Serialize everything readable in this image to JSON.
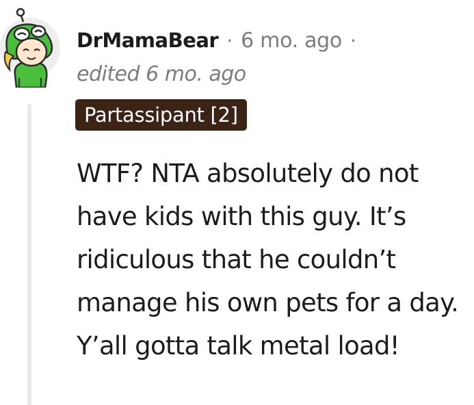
{
  "comment": {
    "author": "DrMamaBear",
    "separator": "·",
    "timestamp": "6 mo. ago",
    "edited": "edited 6 mo. ago",
    "flair": "Partassipant [2]",
    "body": "WTF? NTA absolutely do not have kids with this guy. It’s ridiculous that he couldn’t manage his own pets for a day. Y’all gotta talk metal load!"
  },
  "colors": {
    "text": "#1c1c1c",
    "meta": "#7c7c7c",
    "flair_bg": "#3b2316",
    "flair_text": "#ffffff",
    "thread_line": "#e9eaeb"
  },
  "icons": {
    "avatar": "frog-hood-avatar-icon"
  }
}
